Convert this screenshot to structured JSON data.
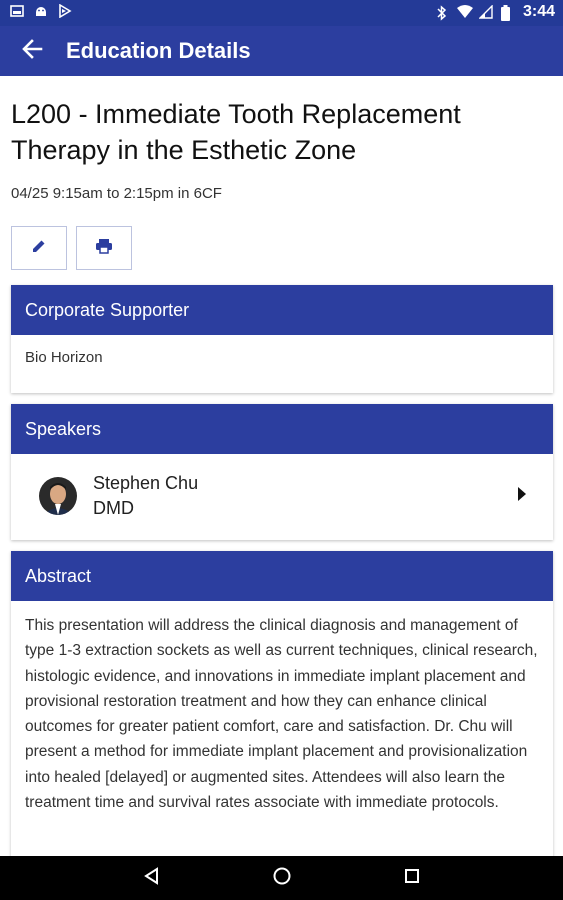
{
  "status_bar": {
    "time": "3:44",
    "left_icons": [
      "screenshot-icon",
      "android-icon",
      "play-store-icon"
    ],
    "right_icons": [
      "bluetooth-icon",
      "wifi-icon",
      "signal-icon",
      "battery-icon"
    ]
  },
  "app_bar": {
    "title": "Education Details",
    "back_icon": "arrow-back-icon"
  },
  "event": {
    "title": "L200 - Immediate Tooth Replacement Therapy in the Esthetic Zone",
    "when": "04/25 9:15am to 2:15pm in 6CF"
  },
  "actions": {
    "edit_icon": "pencil-icon",
    "print_icon": "printer-icon"
  },
  "corporate_supporter": {
    "header": "Corporate Supporter",
    "value": "Bio Horizon"
  },
  "speakers": {
    "header": "Speakers",
    "items": [
      {
        "name": "Stephen Chu",
        "credential": "DMD"
      }
    ]
  },
  "abstract": {
    "header": "Abstract",
    "text": "This presentation will address the clinical diagnosis and management of type 1-3 extraction sockets as well as current techniques, clinical research, histologic evidence, and innovations in immediate implant placement and provisional restoration treatment and how they can enhance clinical outcomes for greater patient comfort, care and satisfaction. Dr. Chu will present a method for immediate implant placement and provisionalization into healed [delayed] or augmented sites. Attendees will also learn the treatment time and survival rates associate with immediate protocols."
  },
  "colors": {
    "primary": "#2c3e9f",
    "status_bar": "#243a97",
    "nav_bar": "#000000"
  }
}
